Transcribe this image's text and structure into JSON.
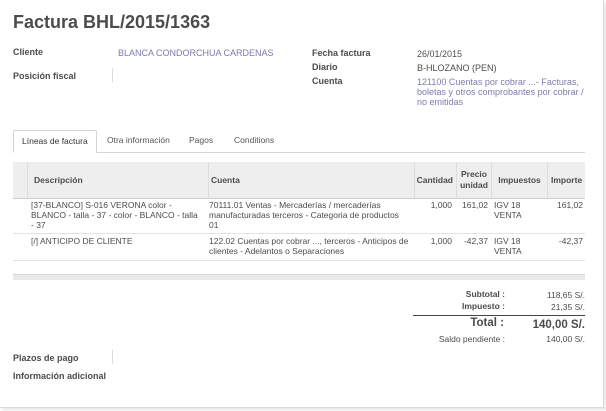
{
  "invoice": {
    "title": "Factura BHL/2015/1363"
  },
  "partner": {
    "client_label": "Cliente",
    "client_value": "BLANCA CONDORCHUA CARDENAS",
    "fiscal_label": "Posición fiscal",
    "fiscal_value": ""
  },
  "meta": {
    "date_label": "Fecha factura",
    "date_value": "26/01/2015",
    "journal_label": "Diario",
    "journal_value": "B-HLOZANO (PEN)",
    "account_label": "Cuenta",
    "account_lines": [
      "121100 Cuentas por cobrar ...- Facturas,",
      "boletas y otros comprobantes por cobrar /",
      "no emitidas"
    ]
  },
  "tabs": [
    {
      "label": "Líneas de factura",
      "active": true
    },
    {
      "label": "Otra información",
      "active": false
    },
    {
      "label": "Pagos",
      "active": false
    },
    {
      "label": "Conditions",
      "active": false
    }
  ],
  "lines_table": {
    "headers": {
      "description": "Descripción",
      "account": "Cuenta",
      "quantity": "Cantidad",
      "unit_price_1": "Precio",
      "unit_price_2": "unidad",
      "taxes": "Impuestos",
      "amount": "Importe"
    },
    "rows": [
      {
        "description": [
          "[37-BLANCO] S-016 VERONA color -",
          "BLANCO - talla - 37 - color - BLANCO - talla",
          "- 37"
        ],
        "account": [
          "70111.01 Ventas - Mercaderías / mercaderías",
          "manufacturadas terceros - Categoria de productos",
          "01"
        ],
        "quantity": "1,000",
        "price": "161,02",
        "taxes": [
          "IGV 18",
          "VENTA"
        ],
        "amount": "161,02"
      },
      {
        "description": [
          "[/] ANTICIPO DE CLIENTE"
        ],
        "account": [
          "122.02 Cuentas por cobrar ..., terceros - Anticipos de",
          "clientes - Adelantos o Separaciones"
        ],
        "quantity": "1,000",
        "price": "-42,37",
        "taxes": [
          "IGV 18",
          "VENTA"
        ],
        "amount": "-42,37"
      }
    ]
  },
  "totals": {
    "subtotal_label": "Subtotal :",
    "subtotal_value": "118,65 S/.",
    "tax_label": "Impuesto :",
    "tax_value": "21,35 S/.",
    "total_label": "Total :",
    "total_value": "140,00 S/.",
    "pending_label": "Saldo pendiente :",
    "pending_value": "140,00 S/."
  },
  "footer": {
    "payment_terms_label": "Plazos de pago",
    "payment_terms_value": "",
    "additional_info_label": "Información adicional"
  }
}
